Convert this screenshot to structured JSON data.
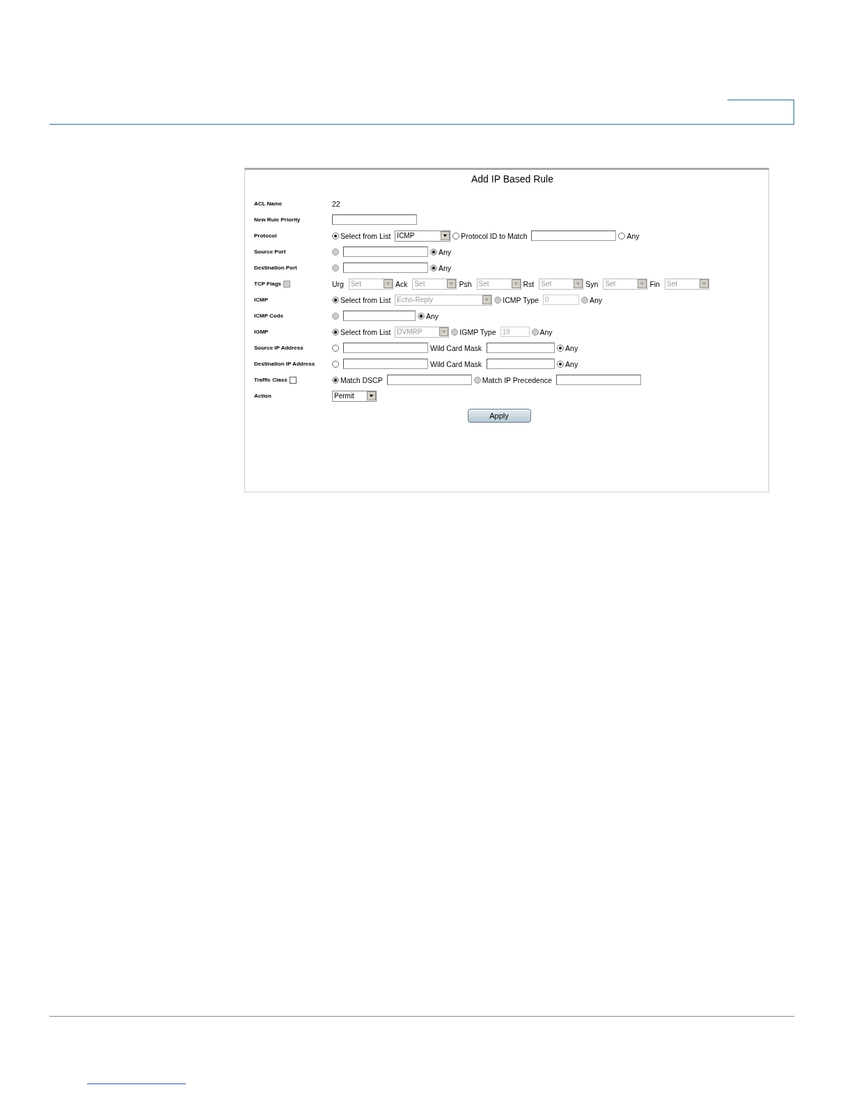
{
  "panel": {
    "title": "Add IP Based Rule"
  },
  "rows": [
    {
      "label": "ACL Name",
      "items": [
        {
          "kind": "text",
          "text": "22"
        }
      ]
    },
    {
      "label": "New Rule Priority",
      "items": [
        {
          "kind": "input",
          "disabled": false
        }
      ]
    },
    {
      "label": "Protocol",
      "items": [
        {
          "kind": "radio",
          "selected": true,
          "disabled": false,
          "text": "Select from List"
        },
        {
          "kind": "select",
          "value": "ICMP",
          "disabled": false
        },
        {
          "kind": "radio",
          "selected": false,
          "disabled": false,
          "text": "Protocol ID to Match"
        },
        {
          "kind": "input",
          "disabled": false
        },
        {
          "kind": "radio",
          "selected": false,
          "disabled": false,
          "text": "Any"
        }
      ]
    },
    {
      "label": "Source Port",
      "items": [
        {
          "kind": "radio",
          "selected": false,
          "disabled": true
        },
        {
          "kind": "input",
          "disabled": false
        },
        {
          "kind": "radio",
          "selected": true,
          "disabled": true,
          "text": "Any"
        }
      ]
    },
    {
      "label": "Destination Port",
      "items": [
        {
          "kind": "radio",
          "selected": false,
          "disabled": true
        },
        {
          "kind": "input",
          "disabled": false
        },
        {
          "kind": "radio",
          "selected": true,
          "disabled": true,
          "text": "Any"
        }
      ]
    },
    {
      "label": "TCP Flags",
      "checkbox": {
        "checked": false,
        "disabled": true
      },
      "items": [
        {
          "kind": "text",
          "text": "Urg"
        },
        {
          "kind": "select",
          "value": "Set",
          "disabled": true
        },
        {
          "kind": "text",
          "text": "Ack"
        },
        {
          "kind": "select",
          "value": "Set",
          "disabled": true
        },
        {
          "kind": "text",
          "text": "Psh"
        },
        {
          "kind": "select",
          "value": "Set",
          "disabled": true
        },
        {
          "kind": "text",
          "text": "Rst"
        },
        {
          "kind": "select",
          "value": "Set",
          "disabled": true
        },
        {
          "kind": "text",
          "text": "Syn"
        },
        {
          "kind": "select",
          "value": "Set",
          "disabled": true
        },
        {
          "kind": "text",
          "text": "Fin"
        },
        {
          "kind": "select",
          "value": "Set",
          "disabled": true
        }
      ]
    },
    {
      "label": "ICMP",
      "items": [
        {
          "kind": "radio",
          "selected": true,
          "disabled": true,
          "text": "Select from List"
        },
        {
          "kind": "select",
          "value": "Echo-Reply",
          "disabled": true
        },
        {
          "kind": "radio",
          "selected": false,
          "disabled": true,
          "text": "ICMP Type"
        },
        {
          "kind": "input",
          "value": "0",
          "disabled": true
        },
        {
          "kind": "radio",
          "selected": false,
          "disabled": true,
          "text": "Any"
        }
      ]
    },
    {
      "label": "ICMP Code",
      "items": [
        {
          "kind": "radio",
          "selected": false,
          "disabled": true
        },
        {
          "kind": "input",
          "disabled": false
        },
        {
          "kind": "radio",
          "selected": true,
          "disabled": true,
          "text": "Any"
        }
      ]
    },
    {
      "label": "IGMP",
      "items": [
        {
          "kind": "radio",
          "selected": true,
          "disabled": true,
          "text": "Select from List"
        },
        {
          "kind": "select",
          "value": "DVMRP",
          "disabled": true
        },
        {
          "kind": "radio",
          "selected": false,
          "disabled": true,
          "text": "IGMP Type"
        },
        {
          "kind": "input",
          "value": "19",
          "disabled": true
        },
        {
          "kind": "radio",
          "selected": false,
          "disabled": true,
          "text": "Any"
        }
      ]
    },
    {
      "label": "Source IP Address",
      "items": [
        {
          "kind": "radio",
          "selected": false,
          "disabled": false
        },
        {
          "kind": "input",
          "disabled": false
        },
        {
          "kind": "text",
          "text": "Wild Card Mask"
        },
        {
          "kind": "input",
          "disabled": false
        },
        {
          "kind": "radio",
          "selected": true,
          "disabled": false,
          "text": "Any"
        }
      ]
    },
    {
      "label": "Destination IP Address",
      "items": [
        {
          "kind": "radio",
          "selected": false,
          "disabled": false
        },
        {
          "kind": "input",
          "disabled": false
        },
        {
          "kind": "text",
          "text": "Wild Card Mask"
        },
        {
          "kind": "input",
          "disabled": false
        },
        {
          "kind": "radio",
          "selected": true,
          "disabled": false,
          "text": "Any"
        }
      ]
    },
    {
      "label": "Traffic Class",
      "checkbox": {
        "checked": false,
        "disabled": false
      },
      "items": [
        {
          "kind": "radio",
          "selected": true,
          "disabled": true,
          "text": "Match DSCP"
        },
        {
          "kind": "input",
          "disabled": false
        },
        {
          "kind": "radio",
          "selected": false,
          "disabled": true,
          "text": "Match IP Precedence"
        },
        {
          "kind": "input",
          "disabled": false
        }
      ]
    },
    {
      "label": "Action",
      "items": [
        {
          "kind": "select",
          "value": "Permit",
          "disabled": false
        }
      ]
    }
  ],
  "apply_button": "Apply"
}
